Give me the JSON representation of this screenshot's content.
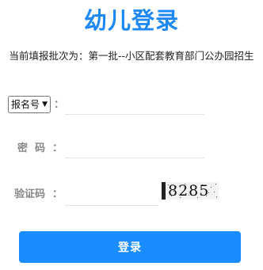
{
  "colors": {
    "accent": "#1e88f5",
    "button": "#1a8cff",
    "label": "#888888"
  },
  "header": {
    "title": "幼儿登录",
    "subtitle": "当前填报批次为：第一批--小区配套教育部门公办园招生"
  },
  "form": {
    "id_type_select": {
      "selected": "报名号",
      "caret_icon": "caret-down-icon"
    },
    "id_colon": "：",
    "id_value": "",
    "password_label": "密  码",
    "password_colon": "：",
    "password_value": "",
    "captcha_label": "验证码",
    "captcha_colon": "：",
    "captcha_value": "",
    "captcha_image_text": "8285"
  },
  "actions": {
    "login_label": "登录"
  }
}
